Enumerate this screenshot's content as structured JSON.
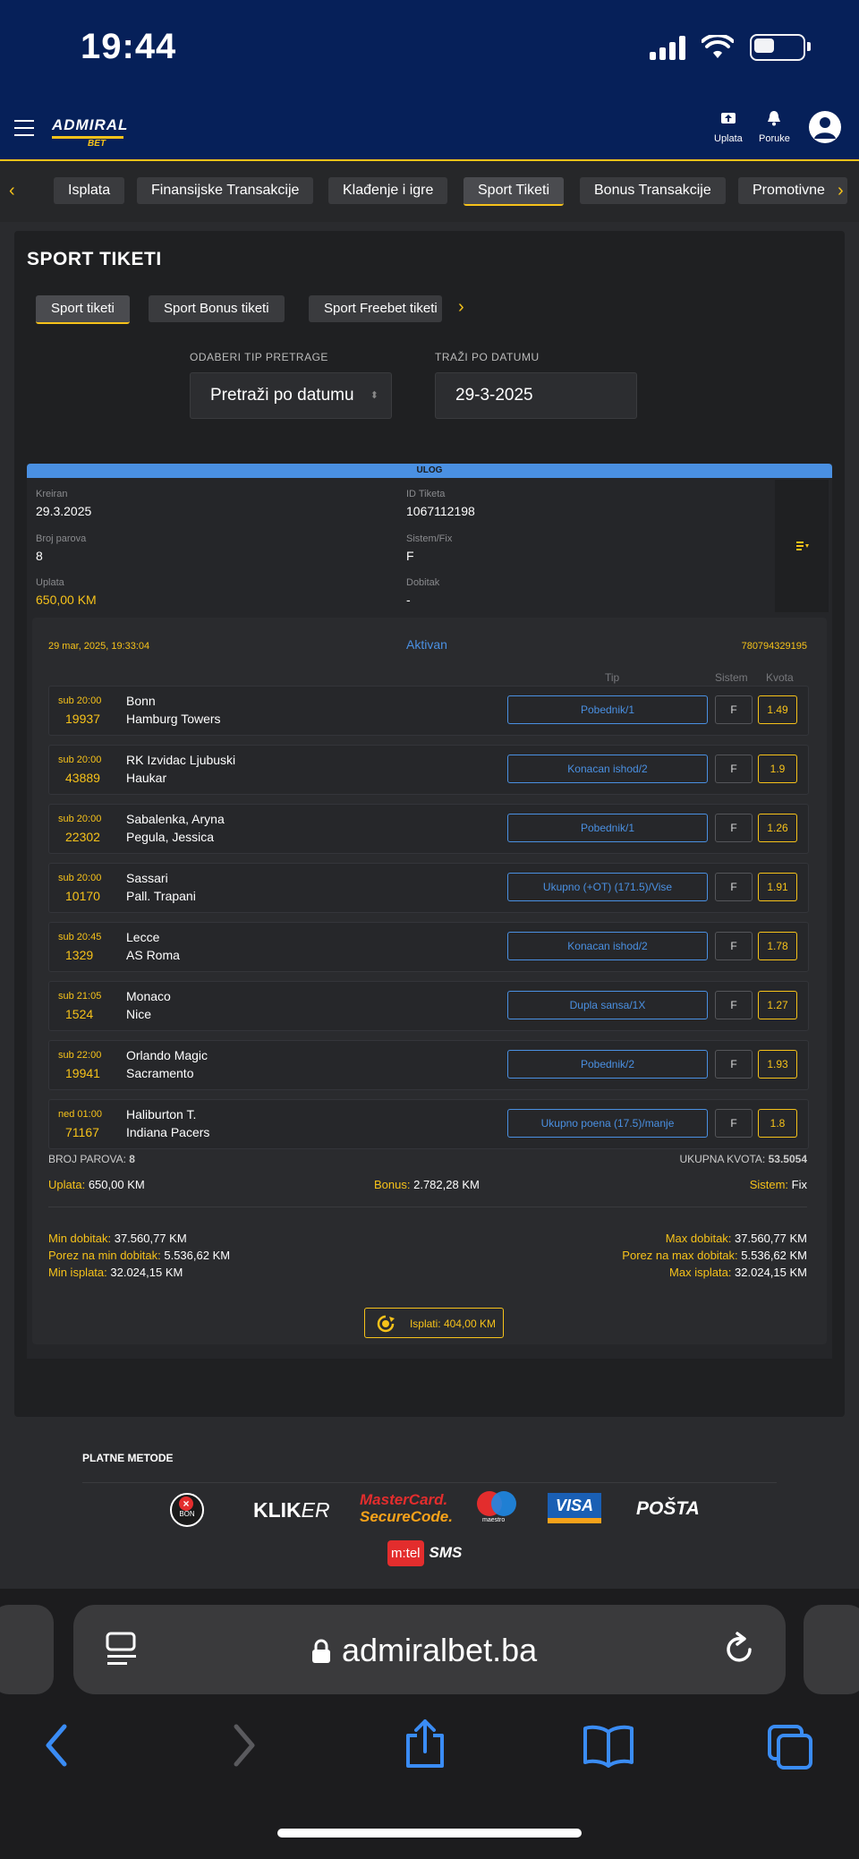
{
  "status": {
    "time": "19:44"
  },
  "header": {
    "logo_top": "ADMIRAL",
    "logo_bottom": "BET",
    "deposit_label": "Uplata",
    "messages_label": "Poruke"
  },
  "tabs": [
    "Isplata",
    "Finansijske Transakcije",
    "Klađenje i igre",
    "Sport Tiketi",
    "Bonus Transakcije",
    "Promotivne"
  ],
  "page": {
    "title": "SPORT TIKETI",
    "subtabs": [
      "Sport tiketi",
      "Sport Bonus tiketi",
      "Sport Freebet tiketi"
    ],
    "search_type_label": "ODABERI TIP PRETRAGE",
    "search_type_value": "Pretraži po datumu",
    "date_label": "TRAŽI PO DATUMU",
    "date_value": "29-3-2025"
  },
  "ticket": {
    "banner": "ULOG",
    "created_label": "Kreiran",
    "created": "29.3.2025",
    "id_label": "ID Tiketa",
    "id": "1067112198",
    "pairs_label": "Broj parova",
    "pairs": "8",
    "system_label": "Sistem/Fix",
    "system": "F",
    "stake_label": "Uplata",
    "stake": "650,00 KM",
    "win_label": "Dobitak",
    "win": "-",
    "detail": {
      "datetime": "29 mar, 2025, 19:33:04",
      "status": "Aktivan",
      "code": "780794329195",
      "col_tip": "Tip",
      "col_sistem": "Sistem",
      "col_kvota": "Kvota",
      "rows": [
        {
          "time": "sub 20:00",
          "code": "19937",
          "home": "Bonn",
          "away": "Hamburg Towers",
          "tip": "Pobednik/1",
          "sys": "F",
          "odd": "1.49"
        },
        {
          "time": "sub 20:00",
          "code": "43889",
          "home": "RK Izvidac Ljubuski",
          "away": "Haukar",
          "tip": "Konacan ishod/2",
          "sys": "F",
          "odd": "1.9"
        },
        {
          "time": "sub 20:00",
          "code": "22302",
          "home": "Sabalenka, Aryna",
          "away": "Pegula, Jessica",
          "tip": "Pobednik/1",
          "sys": "F",
          "odd": "1.26"
        },
        {
          "time": "sub 20:00",
          "code": "10170",
          "home": "Sassari",
          "away": "Pall. Trapani",
          "tip": "Ukupno (+OT) (171.5)/Vise",
          "sys": "F",
          "odd": "1.91"
        },
        {
          "time": "sub 20:45",
          "code": "1329",
          "home": "Lecce",
          "away": "AS Roma",
          "tip": "Konacan ishod/2",
          "sys": "F",
          "odd": "1.78"
        },
        {
          "time": "sub 21:05",
          "code": "1524",
          "home": "Monaco",
          "away": "Nice",
          "tip": "Dupla sansa/1X",
          "sys": "F",
          "odd": "1.27"
        },
        {
          "time": "sub 22:00",
          "code": "19941",
          "home": "Orlando Magic",
          "away": "Sacramento",
          "tip": "Pobednik/2",
          "sys": "F",
          "odd": "1.93"
        },
        {
          "time": "ned 01:00",
          "code": "71167",
          "home": "Haliburton T.",
          "away": "Indiana Pacers",
          "tip": "Ukupno poena (17.5)/manje",
          "sys": "F",
          "odd": "1.8"
        }
      ],
      "pairs_label": "BROJ PAROVA:",
      "pairs": "8",
      "total_odd_label": "UKUPNA KVOTA:",
      "total_odd": "53.5054",
      "stake_label": "Uplata:",
      "stake": "650,00 KM",
      "bonus_label": "Bonus:",
      "bonus": "2.782,28 KM",
      "system_label": "Sistem:",
      "system": "Fix",
      "min_win_label": "Min dobitak:",
      "min_win": "37.560,77 KM",
      "max_win_label": "Max dobitak:",
      "max_win": "37.560,77 KM",
      "tax_min_label": "Porez na min dobitak:",
      "tax_min": "5.536,62 KM",
      "tax_max_label": "Porez na max dobitak:",
      "tax_max": "5.536,62 KM",
      "min_payout_label": "Min isplata:",
      "min_payout": "32.024,15 KM",
      "max_payout_label": "Max isplata:",
      "max_payout": "32.024,15 KM",
      "cashout": "Isplati: 404,00 KM"
    }
  },
  "footer": {
    "title": "PLATNE METODE",
    "methods": [
      "BON",
      "KLIK",
      "ER",
      "MasterCard.",
      "SecureCode.",
      "maestro",
      "VISA",
      "POŠTA",
      "m:tel",
      "SMS"
    ]
  },
  "browser": {
    "url": "admiralbet.ba"
  },
  "colors": {
    "navy": "#062059",
    "gold": "#f6c21a",
    "blue": "#4a90e2",
    "panel": "#1f2022"
  }
}
